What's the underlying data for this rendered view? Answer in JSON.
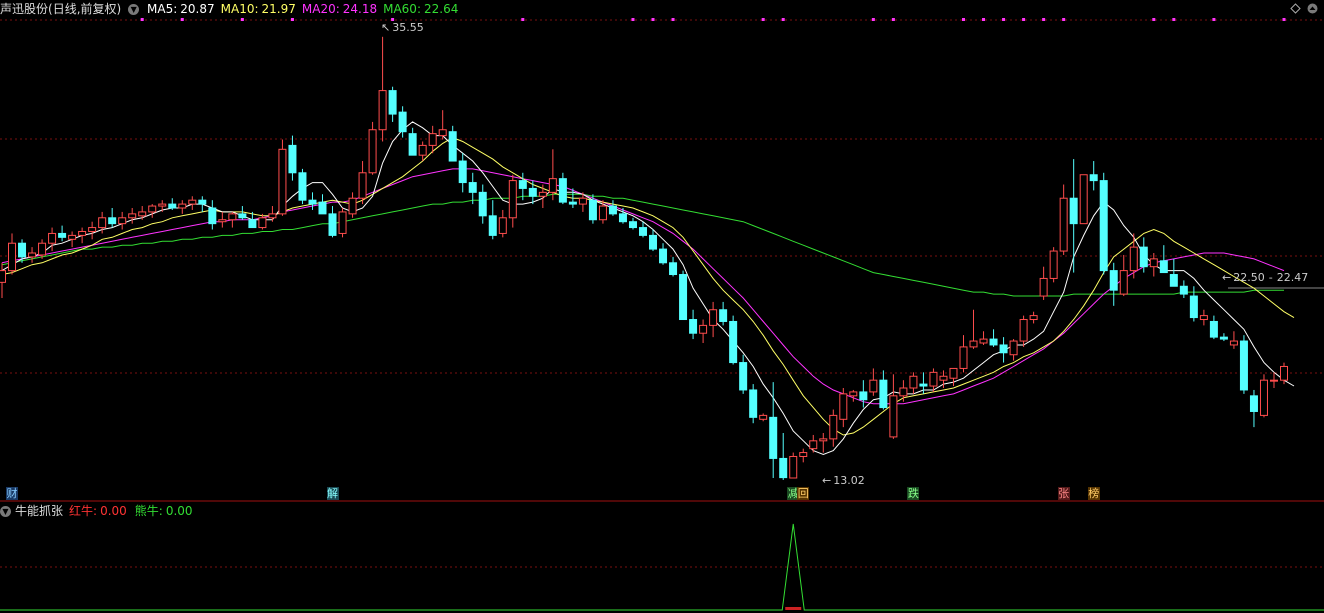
{
  "header": {
    "title": "声迅股份",
    "period": "(日线,前复权)",
    "ma_items": [
      {
        "label": "MA5:",
        "value": "20.87",
        "color": "#ffffff"
      },
      {
        "label": "MA10:",
        "value": "21.97",
        "color": "#ffff66"
      },
      {
        "label": "MA20:",
        "value": "24.18",
        "color": "#ff33ff"
      },
      {
        "label": "MA60:",
        "value": "22.64",
        "color": "#33dd33"
      }
    ]
  },
  "indicator": {
    "name": "牛能抓张",
    "items": [
      {
        "label": "红牛:",
        "value": "0.00",
        "color": "#ff3333"
      },
      {
        "label": "熊牛:",
        "value": "0.00",
        "color": "#33dd33"
      }
    ]
  },
  "annotations": {
    "high_label": "35.55",
    "low_label": "13.02",
    "current_label": "22.50",
    "current_value": "22.47"
  },
  "badges": [
    {
      "text": "财",
      "bg": "#1a3a66",
      "fg": "#88ccff"
    },
    {
      "text": "解",
      "bg": "#1a4a55",
      "fg": "#88ffff"
    },
    {
      "text": "减",
      "bg": "#1a4a22",
      "fg": "#88ff88"
    },
    {
      "text": "回",
      "bg": "#553300",
      "fg": "#ffcc66"
    },
    {
      "text": "跌",
      "bg": "#1a4a22",
      "fg": "#88ff88"
    },
    {
      "text": "张",
      "bg": "#551a1a",
      "fg": "#ff8888"
    },
    {
      "text": "榜",
      "bg": "#553300",
      "fg": "#ffcc66"
    }
  ],
  "colors": {
    "up": "#ff4d4d",
    "down": "#54ffff",
    "grid": "#7a1010",
    "ma5": "#ffffff",
    "ma10": "#ffff66",
    "ma20": "#ff33ff",
    "ma60": "#33dd33",
    "event_dot": "#ff33ff",
    "indicator_line": "#33dd33"
  },
  "chart_data": {
    "type": "candlestick",
    "ylim": [
      12,
      37
    ],
    "series_ma": [
      "MA5",
      "MA10",
      "MA20",
      "MA60"
    ],
    "x": [
      "1",
      "2",
      "3",
      "4",
      "5",
      "6",
      "7",
      "8",
      "9",
      "10",
      "11",
      "12",
      "13",
      "14",
      "15",
      "16",
      "17",
      "18",
      "19",
      "20",
      "21",
      "22",
      "23",
      "24",
      "25",
      "26",
      "27",
      "28",
      "29",
      "30",
      "31",
      "32",
      "33",
      "34",
      "35",
      "36",
      "37",
      "38",
      "39",
      "40",
      "41",
      "42",
      "43",
      "44",
      "45",
      "46",
      "47",
      "48",
      "49",
      "50",
      "51",
      "52",
      "53",
      "54",
      "55",
      "56",
      "57",
      "58",
      "59",
      "60",
      "61",
      "62",
      "63",
      "64",
      "65",
      "66",
      "67",
      "68",
      "69",
      "70",
      "71",
      "72",
      "73",
      "74",
      "75",
      "76",
      "77",
      "78",
      "79",
      "80",
      "81",
      "82",
      "83",
      "84",
      "85",
      "86",
      "87",
      "88",
      "89",
      "90",
      "91",
      "92",
      "93",
      "94",
      "95",
      "96",
      "97",
      "98",
      "99",
      "100",
      "101",
      "102",
      "103",
      "104",
      "105",
      "106",
      "107",
      "108",
      "109",
      "110",
      "111",
      "112",
      "113",
      "114",
      "115",
      "116",
      "117",
      "118",
      "119",
      "120",
      "121",
      "122",
      "123",
      "124",
      "125",
      "126",
      "127",
      "128",
      "129"
    ],
    "ohlc": [
      [
        23.0,
        24.0,
        22.2,
        23.6
      ],
      [
        23.6,
        25.5,
        23.4,
        25.0
      ],
      [
        25.0,
        25.2,
        24.0,
        24.3
      ],
      [
        24.3,
        24.8,
        24.0,
        24.5
      ],
      [
        24.4,
        25.2,
        24.2,
        25.0
      ],
      [
        25.0,
        25.8,
        24.6,
        25.5
      ],
      [
        25.5,
        25.9,
        25.1,
        25.3
      ],
      [
        25.2,
        25.6,
        24.8,
        25.4
      ],
      [
        25.4,
        25.8,
        25.0,
        25.6
      ],
      [
        25.6,
        26.1,
        25.2,
        25.8
      ],
      [
        25.8,
        26.6,
        25.5,
        26.3
      ],
      [
        26.3,
        26.8,
        25.8,
        26.0
      ],
      [
        26.0,
        26.6,
        25.7,
        26.3
      ],
      [
        26.3,
        26.8,
        26.0,
        26.5
      ],
      [
        26.4,
        26.9,
        26.2,
        26.6
      ],
      [
        26.6,
        27.0,
        26.3,
        26.9
      ],
      [
        26.9,
        27.2,
        26.6,
        27.0
      ],
      [
        27.0,
        27.3,
        26.7,
        26.8
      ],
      [
        26.8,
        27.2,
        26.5,
        27.0
      ],
      [
        27.0,
        27.4,
        26.7,
        27.2
      ],
      [
        27.2,
        27.4,
        26.6,
        27.0
      ],
      [
        26.8,
        27.2,
        25.7,
        26.0
      ],
      [
        26.1,
        26.6,
        25.8,
        26.2
      ],
      [
        26.2,
        26.6,
        25.8,
        26.5
      ],
      [
        26.5,
        26.9,
        26.2,
        26.3
      ],
      [
        26.2,
        26.6,
        25.8,
        25.8
      ],
      [
        25.8,
        26.5,
        25.7,
        26.3
      ],
      [
        26.3,
        26.9,
        26.1,
        26.5
      ],
      [
        26.5,
        30.3,
        26.4,
        29.8
      ],
      [
        30.0,
        30.5,
        28.2,
        28.6
      ],
      [
        28.6,
        28.8,
        27.0,
        27.2
      ],
      [
        27.2,
        27.6,
        26.7,
        27.0
      ],
      [
        27.1,
        27.5,
        26.6,
        26.5
      ],
      [
        26.5,
        26.9,
        25.3,
        25.4
      ],
      [
        25.5,
        26.8,
        25.3,
        26.6
      ],
      [
        26.5,
        27.6,
        26.3,
        27.3
      ],
      [
        27.3,
        29.2,
        27.0,
        28.6
      ],
      [
        28.6,
        31.2,
        28.5,
        30.8
      ],
      [
        30.8,
        35.55,
        30.2,
        32.8
      ],
      [
        32.8,
        33.0,
        31.2,
        31.6
      ],
      [
        31.7,
        32.0,
        30.4,
        30.7
      ],
      [
        30.6,
        30.9,
        29.6,
        29.5
      ],
      [
        29.5,
        30.2,
        29.2,
        30.0
      ],
      [
        30.0,
        31.0,
        29.6,
        30.6
      ],
      [
        30.5,
        31.8,
        30.3,
        30.8
      ],
      [
        30.7,
        31.0,
        29.2,
        29.2
      ],
      [
        29.2,
        29.6,
        27.6,
        28.1
      ],
      [
        28.1,
        28.6,
        27.0,
        27.6
      ],
      [
        27.6,
        28.0,
        26.0,
        26.4
      ],
      [
        26.4,
        27.2,
        25.2,
        25.4
      ],
      [
        25.5,
        26.7,
        25.3,
        26.3
      ],
      [
        26.3,
        28.5,
        25.8,
        28.2
      ],
      [
        28.2,
        28.6,
        27.2,
        27.8
      ],
      [
        27.8,
        28.2,
        27.0,
        27.4
      ],
      [
        27.4,
        28.0,
        26.8,
        27.6
      ],
      [
        27.6,
        29.8,
        27.2,
        28.3
      ],
      [
        28.3,
        28.6,
        27.0,
        27.1
      ],
      [
        27.1,
        27.8,
        26.8,
        27.0
      ],
      [
        27.0,
        27.6,
        26.6,
        27.3
      ],
      [
        27.2,
        27.5,
        26.0,
        26.2
      ],
      [
        26.2,
        27.2,
        26.0,
        26.9
      ],
      [
        26.9,
        27.2,
        26.4,
        26.5
      ],
      [
        26.5,
        26.8,
        26.0,
        26.1
      ],
      [
        26.1,
        26.3,
        25.7,
        25.8
      ],
      [
        25.8,
        26.1,
        25.3,
        25.4
      ],
      [
        25.4,
        25.7,
        24.6,
        24.7
      ],
      [
        24.7,
        25.0,
        23.9,
        24.0
      ],
      [
        24.0,
        24.3,
        23.3,
        23.4
      ],
      [
        23.4,
        23.6,
        21.1,
        21.1
      ],
      [
        21.1,
        21.6,
        20.1,
        20.4
      ],
      [
        20.4,
        21.1,
        19.9,
        20.8
      ],
      [
        20.8,
        22.0,
        20.2,
        21.6
      ],
      [
        21.6,
        22.0,
        20.8,
        21.0
      ],
      [
        21.0,
        21.3,
        18.8,
        18.9
      ],
      [
        18.9,
        19.3,
        17.3,
        17.5
      ],
      [
        17.5,
        17.8,
        15.8,
        16.1
      ],
      [
        16.0,
        16.3,
        15.9,
        16.2
      ],
      [
        16.1,
        17.9,
        13.0,
        14.0
      ],
      [
        14.0,
        15.3,
        12.9,
        13.02
      ],
      [
        13.0,
        14.3,
        13.1,
        14.1
      ],
      [
        14.1,
        14.5,
        13.8,
        14.3
      ],
      [
        14.5,
        15.2,
        14.3,
        14.9
      ],
      [
        14.9,
        15.3,
        14.3,
        15.0
      ],
      [
        15.0,
        16.5,
        14.6,
        16.2
      ],
      [
        16.0,
        17.6,
        15.6,
        17.3
      ],
      [
        17.2,
        17.5,
        16.9,
        17.4
      ],
      [
        17.4,
        18.0,
        16.6,
        17.0
      ],
      [
        17.4,
        18.6,
        17.2,
        18.0
      ],
      [
        18.0,
        18.5,
        16.5,
        16.6
      ],
      [
        15.1,
        18.3,
        15.0,
        17.2
      ],
      [
        17.2,
        18.0,
        16.9,
        17.6
      ],
      [
        17.6,
        18.4,
        17.3,
        18.2
      ],
      [
        17.8,
        18.4,
        17.3,
        17.7
      ],
      [
        17.7,
        18.6,
        17.4,
        18.4
      ],
      [
        18.0,
        18.5,
        17.6,
        18.2
      ],
      [
        18.1,
        18.6,
        17.7,
        18.6
      ],
      [
        18.6,
        20.3,
        18.4,
        19.7
      ],
      [
        19.7,
        21.6,
        19.6,
        20.0
      ],
      [
        19.9,
        20.5,
        19.8,
        20.1
      ],
      [
        20.1,
        20.6,
        19.7,
        19.8
      ],
      [
        19.8,
        20.2,
        18.9,
        19.4
      ],
      [
        19.3,
        20.1,
        19.0,
        20.0
      ],
      [
        20.0,
        21.3,
        19.7,
        21.1
      ],
      [
        21.1,
        21.5,
        20.9,
        21.3
      ],
      [
        22.3,
        23.8,
        22.1,
        23.2
      ],
      [
        23.2,
        24.8,
        23.0,
        24.6
      ],
      [
        24.6,
        28.0,
        24.4,
        27.3
      ],
      [
        27.3,
        29.3,
        23.5,
        26.0
      ],
      [
        26.0,
        26.4,
        26.3,
        28.5
      ],
      [
        28.5,
        29.2,
        27.7,
        28.2
      ],
      [
        28.2,
        28.6,
        23.4,
        23.6
      ],
      [
        23.6,
        24.0,
        21.8,
        22.6
      ],
      [
        22.4,
        24.4,
        22.3,
        23.6
      ],
      [
        23.6,
        25.5,
        23.2,
        24.8
      ],
      [
        24.8,
        25.3,
        23.5,
        23.8
      ],
      [
        23.8,
        24.5,
        23.3,
        24.2
      ],
      [
        24.1,
        24.9,
        23.6,
        23.5
      ],
      [
        23.4,
        24.2,
        23.0,
        22.8
      ],
      [
        22.8,
        23.1,
        22.2,
        22.4
      ],
      [
        22.3,
        22.8,
        21.0,
        21.2
      ],
      [
        21.1,
        21.6,
        20.8,
        21.3
      ],
      [
        21.0,
        21.3,
        20.1,
        20.2
      ],
      [
        20.2,
        20.4,
        20.0,
        20.1
      ],
      [
        19.8,
        20.5,
        19.6,
        20.0
      ],
      [
        20.0,
        20.3,
        17.3,
        17.5
      ],
      [
        17.2,
        17.5,
        15.6,
        16.4
      ],
      [
        16.2,
        18.3,
        16.1,
        18.0
      ],
      [
        18.0,
        18.4,
        17.6,
        18.0
      ],
      [
        18.0,
        18.9,
        17.8,
        18.7
      ]
    ],
    "ma5": [
      23.6,
      23.9,
      24.2,
      24.3,
      24.5,
      24.9,
      25.0,
      25.2,
      25.4,
      25.5,
      25.7,
      25.8,
      26.0,
      26.2,
      26.3,
      26.5,
      26.7,
      26.8,
      26.8,
      27.0,
      27.0,
      26.8,
      26.6,
      26.6,
      26.4,
      26.2,
      26.2,
      26.2,
      26.9,
      27.4,
      27.8,
      28.1,
      28.1,
      27.5,
      26.8,
      26.6,
      26.8,
      27.4,
      29.1,
      30.2,
      30.8,
      31.2,
      30.9,
      30.5,
      30.5,
      30.0,
      29.6,
      29.2,
      28.6,
      27.9,
      27.2,
      27.0,
      27.0,
      27.1,
      27.3,
      27.8,
      27.6,
      27.6,
      27.5,
      27.2,
      27.0,
      26.8,
      26.6,
      26.4,
      26.1,
      25.7,
      25.2,
      24.7,
      23.9,
      22.7,
      21.9,
      21.1,
      20.6,
      20.0,
      19.4,
      18.7,
      17.8,
      17.1,
      16.3,
      15.4,
      14.9,
      14.4,
      14.2,
      14.4,
      15.0,
      15.8,
      16.5,
      17.0,
      17.1,
      17.4,
      17.3,
      17.3,
      17.5,
      17.5,
      17.8,
      17.9,
      18.1,
      18.5,
      18.9,
      19.3,
      19.5,
      19.8,
      19.8,
      20.1,
      20.5,
      21.5,
      22.5,
      24.3,
      25.4,
      26.4,
      27.1,
      26.7,
      25.9,
      25.3,
      24.4,
      23.9,
      23.6,
      23.6,
      23.6,
      23.2,
      22.6,
      22.1,
      21.6,
      21.1,
      20.6,
      19.7,
      18.9,
      18.4,
      18.0,
      17.7
    ],
    "ma10": [
      23.4,
      23.5,
      23.7,
      23.9,
      24.0,
      24.2,
      24.4,
      24.5,
      24.7,
      24.9,
      25.2,
      25.3,
      25.5,
      25.7,
      25.8,
      26.0,
      26.1,
      26.3,
      26.4,
      26.5,
      26.6,
      26.7,
      26.6,
      26.6,
      26.6,
      26.5,
      26.4,
      26.4,
      26.6,
      26.8,
      26.9,
      27.0,
      27.1,
      27.2,
      27.1,
      27.0,
      27.2,
      27.5,
      27.8,
      28.1,
      28.4,
      28.8,
      29.2,
      29.7,
      30.1,
      30.4,
      30.2,
      29.9,
      29.6,
      29.3,
      28.9,
      28.6,
      28.3,
      28.0,
      27.8,
      27.6,
      27.4,
      27.3,
      27.3,
      27.2,
      27.1,
      27.0,
      26.9,
      26.8,
      26.6,
      26.4,
      26.1,
      25.8,
      25.3,
      24.6,
      23.9,
      23.2,
      22.6,
      22.1,
      21.6,
      21.0,
      20.3,
      19.5,
      18.8,
      18.0,
      17.2,
      16.6,
      16.0,
      15.5,
      15.2,
      15.3,
      15.6,
      16.0,
      16.4,
      16.8,
      17.1,
      17.2,
      17.3,
      17.4,
      17.5,
      17.6,
      17.8,
      18.0,
      18.2,
      18.4,
      18.7,
      18.9,
      19.2,
      19.4,
      19.7,
      20.0,
      20.5,
      21.1,
      21.8,
      22.6,
      23.5,
      24.3,
      24.7,
      25.1,
      25.5,
      25.7,
      25.5,
      25.1,
      24.8,
      24.5,
      24.2,
      23.9,
      23.6,
      23.3,
      23.0,
      22.7,
      22.3,
      21.9,
      21.5,
      21.2
    ],
    "ma20": [
      24.0,
      24.1,
      24.2,
      24.3,
      24.4,
      24.5,
      24.6,
      24.7,
      24.8,
      24.9,
      25.0,
      25.1,
      25.2,
      25.3,
      25.4,
      25.5,
      25.6,
      25.7,
      25.8,
      25.9,
      26.0,
      26.1,
      26.1,
      26.2,
      26.2,
      26.2,
      26.3,
      26.4,
      26.6,
      26.7,
      26.8,
      26.9,
      27.0,
      27.1,
      27.1,
      27.2,
      27.4,
      27.6,
      27.8,
      28.0,
      28.2,
      28.4,
      28.5,
      28.6,
      28.7,
      28.8,
      28.8,
      28.8,
      28.7,
      28.6,
      28.5,
      28.4,
      28.3,
      28.2,
      28.1,
      28.0,
      27.9,
      27.7,
      27.5,
      27.3,
      27.1,
      26.9,
      26.7,
      26.5,
      26.3,
      26.1,
      25.8,
      25.5,
      25.1,
      24.7,
      24.2,
      23.7,
      23.2,
      22.7,
      22.2,
      21.6,
      21.0,
      20.4,
      19.8,
      19.2,
      18.7,
      18.2,
      17.8,
      17.5,
      17.3,
      17.1,
      16.9,
      16.8,
      16.8,
      16.8,
      16.8,
      16.9,
      17.0,
      17.1,
      17.2,
      17.3,
      17.5,
      17.7,
      17.9,
      18.1,
      18.4,
      18.7,
      19.0,
      19.3,
      19.6,
      20.0,
      20.4,
      20.9,
      21.4,
      21.9,
      22.4,
      22.8,
      23.2,
      23.5,
      23.8,
      24.0,
      24.1,
      24.2,
      24.3,
      24.4,
      24.5,
      24.5,
      24.5,
      24.4,
      24.3,
      24.2,
      24.0,
      23.8,
      23.6
    ],
    "ma60": [
      23.9,
      24.0,
      24.1,
      24.2,
      24.3,
      24.4,
      24.5,
      24.6,
      24.7,
      24.7,
      24.8,
      24.8,
      24.9,
      24.9,
      25.0,
      25.0,
      25.1,
      25.1,
      25.2,
      25.2,
      25.3,
      25.3,
      25.4,
      25.4,
      25.5,
      25.5,
      25.6,
      25.6,
      25.7,
      25.7,
      25.8,
      25.9,
      26.0,
      26.0,
      26.1,
      26.2,
      26.3,
      26.4,
      26.5,
      26.6,
      26.7,
      26.8,
      26.9,
      27.0,
      27.0,
      27.1,
      27.1,
      27.2,
      27.2,
      27.3,
      27.3,
      27.3,
      27.4,
      27.4,
      27.4,
      27.5,
      27.5,
      27.5,
      27.5,
      27.4,
      27.4,
      27.3,
      27.3,
      27.2,
      27.1,
      27.0,
      26.9,
      26.8,
      26.7,
      26.6,
      26.5,
      26.4,
      26.3,
      26.2,
      26.1,
      25.9,
      25.7,
      25.5,
      25.3,
      25.1,
      24.9,
      24.7,
      24.5,
      24.3,
      24.1,
      23.9,
      23.7,
      23.5,
      23.4,
      23.3,
      23.2,
      23.1,
      23.0,
      22.9,
      22.8,
      22.7,
      22.6,
      22.5,
      22.5,
      22.4,
      22.4,
      22.3,
      22.3,
      22.3,
      22.3,
      22.3,
      22.3,
      22.4,
      22.4,
      22.4,
      22.4,
      22.4,
      22.4,
      22.4,
      22.4,
      22.4,
      22.4,
      22.4,
      22.5,
      22.5,
      22.5,
      22.5,
      22.5,
      22.5,
      22.5,
      22.6,
      22.6,
      22.6,
      22.6
    ],
    "event_marks": [
      15,
      19,
      25,
      30,
      40,
      53,
      64,
      66,
      68,
      77,
      79,
      88,
      90,
      97,
      99,
      101,
      103,
      105,
      107,
      116,
      118,
      122,
      129
    ],
    "badge_positions": [
      2,
      34,
      80,
      81,
      92,
      107,
      110
    ],
    "indicator": {
      "name": "牛能抓张",
      "red_bull": 0.0,
      "bear_bull": 0.0,
      "spike_at": 80
    }
  }
}
